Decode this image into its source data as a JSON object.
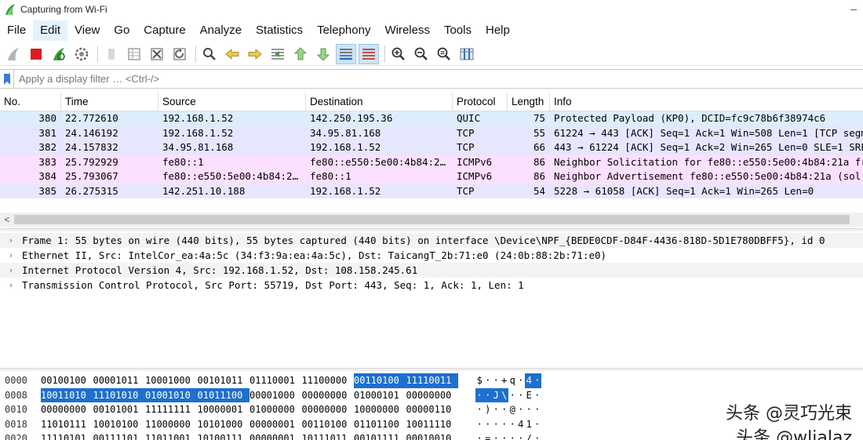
{
  "window": {
    "title": "Capturing from Wi-Fi",
    "minimize_glyph": "–"
  },
  "menu": [
    "File",
    "Edit",
    "View",
    "Go",
    "Capture",
    "Analyze",
    "Statistics",
    "Telephony",
    "Wireless",
    "Tools",
    "Help"
  ],
  "filter": {
    "placeholder": "Apply a display filter … <Ctrl-/>"
  },
  "packet_list": {
    "columns": [
      "No.",
      "Time",
      "Source",
      "Destination",
      "Protocol",
      "Length",
      "Info"
    ],
    "rows": [
      {
        "no": "380",
        "time": "22.772610",
        "source": "192.168.1.52",
        "destination": "142.250.195.36",
        "protocol": "QUIC",
        "length": "75",
        "info": "Protected Payload (KP0), DCID=fc9c78b6f38974c6",
        "bg": "#dceefb"
      },
      {
        "no": "381",
        "time": "24.146192",
        "source": "192.168.1.52",
        "destination": "34.95.81.168",
        "protocol": "TCP",
        "length": "55",
        "info": "61224 → 443 [ACK] Seq=1 Ack=1 Win=508 Len=1 [TCP segm",
        "bg": "#e7e6ff"
      },
      {
        "no": "382",
        "time": "24.157832",
        "source": "34.95.81.168",
        "destination": "192.168.1.52",
        "protocol": "TCP",
        "length": "66",
        "info": "443 → 61224 [ACK] Seq=1 Ack=2 Win=265 Len=0 SLE=1 SRE",
        "bg": "#e7e6ff"
      },
      {
        "no": "383",
        "time": "25.792929",
        "source": "fe80::1",
        "destination": "fe80::e550:5e00:4b84:2…",
        "protocol": "ICMPv6",
        "length": "86",
        "info": "Neighbor Solicitation for fe80::e550:5e00:4b84:21a fr",
        "bg": "#fce0ff"
      },
      {
        "no": "384",
        "time": "25.793067",
        "source": "fe80::e550:5e00:4b84:2…",
        "destination": "fe80::1",
        "protocol": "ICMPv6",
        "length": "86",
        "info": "Neighbor Advertisement fe80::e550:5e00:4b84:21a (sol,",
        "bg": "#fce0ff"
      },
      {
        "no": "385",
        "time": "26.275315",
        "source": "142.251.10.188",
        "destination": "192.168.1.52",
        "protocol": "TCP",
        "length": "54",
        "info": "5228 → 61058 [ACK] Seq=1 Ack=1 Win=265 Len=0",
        "bg": "#e7e6ff"
      }
    ]
  },
  "details": [
    "Frame 1: 55 bytes on wire (440 bits), 55 bytes captured (440 bits) on interface \\Device\\NPF_{BEDE0CDF-D84F-4436-818D-5D1E780DBFF5}, id 0",
    "Ethernet II, Src: IntelCor_ea:4a:5c (34:f3:9a:ea:4a:5c), Dst: TaicangT_2b:71:e0 (24:0b:88:2b:71:e0)",
    "Internet Protocol Version 4, Src: 192.168.1.52, Dst: 108.158.245.61",
    "Transmission Control Protocol, Src Port: 55719, Dst Port: 443, Seq: 1, Ack: 1, Len: 1"
  ],
  "bytes": [
    {
      "offset": "0000",
      "bytes": [
        "00100100",
        "00001011",
        "10001000",
        "00101011",
        "01110001",
        "11100000",
        "00110100",
        "11110011"
      ],
      "sel": [
        6,
        7
      ],
      "ascii": [
        "$",
        "·",
        "·",
        "+",
        "q",
        "·",
        "4",
        "·"
      ],
      "ascii_sel": [
        6,
        7
      ]
    },
    {
      "offset": "0008",
      "bytes": [
        "10011010",
        "11101010",
        "01001010",
        "01011100",
        "00001000",
        "00000000",
        "01000101",
        "00000000"
      ],
      "sel": [
        0,
        1,
        2,
        3
      ],
      "ascii": [
        "·",
        "·",
        "J",
        "\\",
        "·",
        "·",
        "E",
        "·"
      ],
      "ascii_sel": [
        0,
        1,
        2,
        3
      ]
    },
    {
      "offset": "0010",
      "bytes": [
        "00000000",
        "00101001",
        "11111111",
        "10000001",
        "01000000",
        "00000000",
        "10000000",
        "00000110"
      ],
      "sel": [],
      "ascii": [
        "·",
        ")",
        "·",
        "·",
        "@",
        "·",
        "·",
        "·"
      ],
      "ascii_sel": []
    },
    {
      "offset": "0018",
      "bytes": [
        "11010111",
        "10010100",
        "11000000",
        "10101000",
        "00000001",
        "00110100",
        "01101100",
        "10011110"
      ],
      "sel": [],
      "ascii": [
        "·",
        "·",
        "·",
        "·",
        "·",
        "4",
        "1",
        "·"
      ],
      "ascii_sel": []
    },
    {
      "offset": "0020",
      "bytes": [
        "11110101",
        "00111101",
        "11011001",
        "10100111",
        "00000001",
        "10111011",
        "00101111",
        "00010010"
      ],
      "sel": [],
      "ascii": [
        "·",
        "=",
        "·",
        "·",
        "·",
        "·",
        "/",
        "·"
      ],
      "ascii_sel": []
    }
  ],
  "watermark": {
    "line1": "头条 @灵巧光束",
    "line2": "头条 @wlialaz"
  },
  "colors": {
    "selection": "#1e6fcf",
    "menu_active": "#e5f1fb",
    "stop_red": "#d81e1e",
    "shark_green": "#3aa335"
  }
}
